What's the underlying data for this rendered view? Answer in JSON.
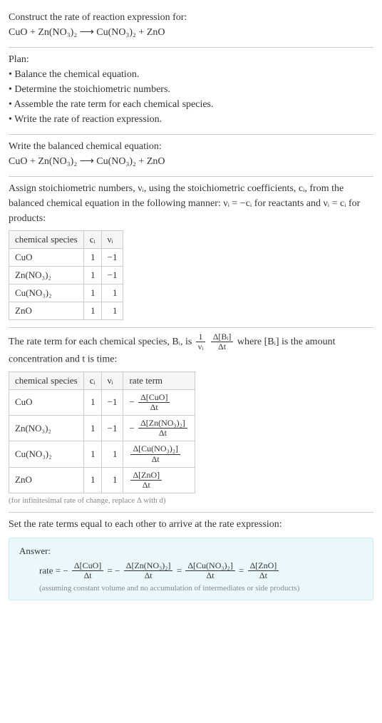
{
  "header": {
    "line1": "Construct the rate of reaction expression for:",
    "equation": "CuO + Zn(NO₃)₂ ⟶ Cu(NO₃)₂ + ZnO"
  },
  "plan": {
    "title": "Plan:",
    "b1": "• Balance the chemical equation.",
    "b2": "• Determine the stoichiometric numbers.",
    "b3": "• Assemble the rate term for each chemical species.",
    "b4": "• Write the rate of reaction expression."
  },
  "balanced": {
    "title": "Write the balanced chemical equation:",
    "equation": "CuO + Zn(NO₃)₂ ⟶ Cu(NO₃)₂ + ZnO"
  },
  "stoich": {
    "intro": "Assign stoichiometric numbers, νᵢ, using the stoichiometric coefficients, cᵢ, from the balanced chemical equation in the following manner: νᵢ = −cᵢ for reactants and νᵢ = cᵢ for products:",
    "headers": {
      "species": "chemical species",
      "ci": "cᵢ",
      "vi": "νᵢ"
    },
    "rows": [
      {
        "species": "CuO",
        "ci": "1",
        "vi": "−1"
      },
      {
        "species": "Zn(NO₃)₂",
        "ci": "1",
        "vi": "−1"
      },
      {
        "species": "Cu(NO₃)₂",
        "ci": "1",
        "vi": "1"
      },
      {
        "species": "ZnO",
        "ci": "1",
        "vi": "1"
      }
    ]
  },
  "rate_intro": {
    "pre": "The rate term for each chemical species, Bᵢ, is ",
    "frac1_num": "1",
    "frac1_den": "νᵢ",
    "frac2_num": "Δ[Bᵢ]",
    "frac2_den": "Δt",
    "post": " where [Bᵢ] is the amount concentration and t is time:"
  },
  "rate_table": {
    "headers": {
      "species": "chemical species",
      "ci": "cᵢ",
      "vi": "νᵢ",
      "term": "rate term"
    },
    "rows": [
      {
        "species": "CuO",
        "ci": "1",
        "vi": "−1",
        "neg": "− ",
        "num": "Δ[CuO]",
        "den": "Δt"
      },
      {
        "species": "Zn(NO₃)₂",
        "ci": "1",
        "vi": "−1",
        "neg": "− ",
        "num": "Δ[Zn(NO₃)₂]",
        "den": "Δt"
      },
      {
        "species": "Cu(NO₃)₂",
        "ci": "1",
        "vi": "1",
        "neg": "",
        "num": "Δ[Cu(NO₃)₂]",
        "den": "Δt"
      },
      {
        "species": "ZnO",
        "ci": "1",
        "vi": "1",
        "neg": "",
        "num": "Δ[ZnO]",
        "den": "Δt"
      }
    ],
    "note": "(for infinitesimal rate of change, replace Δ with d)"
  },
  "final": {
    "title": "Set the rate terms equal to each other to arrive at the rate expression:"
  },
  "answer": {
    "label": "Answer:",
    "lead": "rate = ",
    "minus": "− ",
    "eq": " = ",
    "t1_num": "Δ[CuO]",
    "t1_den": "Δt",
    "t2_num": "Δ[Zn(NO₃)₂]",
    "t2_den": "Δt",
    "t3_num": "Δ[Cu(NO₃)₂]",
    "t3_den": "Δt",
    "t4_num": "Δ[ZnO]",
    "t4_den": "Δt",
    "assume": "(assuming constant volume and no accumulation of intermediates or side products)"
  },
  "chart_data": {
    "type": "table",
    "tables": [
      {
        "title": "Stoichiometric numbers",
        "columns": [
          "chemical species",
          "c_i",
          "ν_i"
        ],
        "rows": [
          [
            "CuO",
            1,
            -1
          ],
          [
            "Zn(NO3)2",
            1,
            -1
          ],
          [
            "Cu(NO3)2",
            1,
            1
          ],
          [
            "ZnO",
            1,
            1
          ]
        ]
      },
      {
        "title": "Rate terms",
        "columns": [
          "chemical species",
          "c_i",
          "ν_i",
          "rate term"
        ],
        "rows": [
          [
            "CuO",
            1,
            -1,
            "-Δ[CuO]/Δt"
          ],
          [
            "Zn(NO3)2",
            1,
            -1,
            "-Δ[Zn(NO3)2]/Δt"
          ],
          [
            "Cu(NO3)2",
            1,
            1,
            "Δ[Cu(NO3)2]/Δt"
          ],
          [
            "ZnO",
            1,
            1,
            "Δ[ZnO]/Δt"
          ]
        ]
      }
    ]
  }
}
